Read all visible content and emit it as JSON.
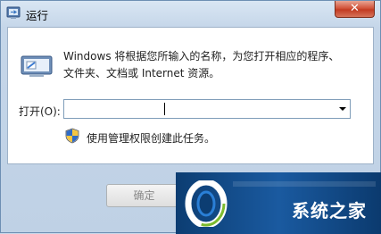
{
  "window": {
    "title": "运行",
    "close_symbol": "✕"
  },
  "description": {
    "line1": "Windows 将根据您所输入的名称，为您打开相应的程序、",
    "line2": "文件夹、文档或 Internet 资源。"
  },
  "open_field": {
    "label": "打开(O):",
    "value": ""
  },
  "admin_note": "使用管理权限创建此任务。",
  "buttons": {
    "ok": "确定"
  },
  "watermark": {
    "brand_text": "系统之家"
  },
  "icons": {
    "title": "run-app-icon",
    "main": "run-program-icon",
    "shield": "uac-shield-icon",
    "dropdown": "chevron-down-icon",
    "watermark_logo": "brand-logo-icon"
  },
  "colors": {
    "close_button": "#c23b22",
    "window_frame": "#c5d6e9",
    "watermark_bg": "#1a5aa0"
  }
}
